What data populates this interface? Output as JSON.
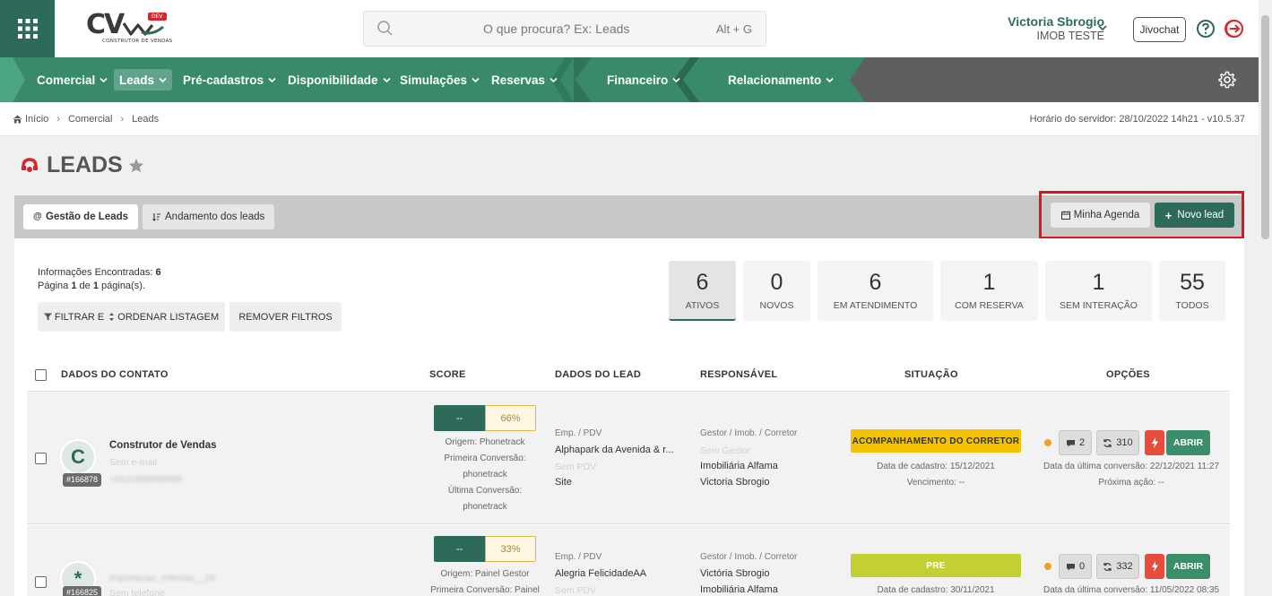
{
  "logo": {
    "text": "CV",
    "badge": "DEV",
    "tagline": "CONSTRUTOR DE VENDAS"
  },
  "search": {
    "placeholder": "O que procura? Ex: Leads",
    "shortcut": "Alt + G"
  },
  "user": {
    "name": "Victoria Sbrogio",
    "org": "IMOB TESTE"
  },
  "header": {
    "jivochat_label": "Jivochat"
  },
  "nav": {
    "items": [
      {
        "label": "Comercial"
      },
      {
        "label": "Leads"
      },
      {
        "label": "Pré-cadastros"
      },
      {
        "label": "Disponibilidade"
      },
      {
        "label": "Simulações"
      },
      {
        "label": "Reservas"
      },
      {
        "label": "Financeiro"
      },
      {
        "label": "Relacionamento"
      }
    ]
  },
  "breadcrumb": {
    "items": [
      "Início",
      "Comercial",
      "Leads"
    ],
    "server_time": "Horário do servidor: 28/10/2022 14h21 - v10.5.37"
  },
  "page": {
    "title": "LEADS"
  },
  "tabs": [
    {
      "label": "Gestão de Leads"
    },
    {
      "label": "Andamento dos leads"
    }
  ],
  "actions": {
    "agenda": "Minha Agenda",
    "new_lead": "Novo lead"
  },
  "info": {
    "found_label": "Informações Encontradas:",
    "found_count": "6",
    "page_label": "Página",
    "page_num": "1",
    "of_label": "de",
    "total_pages": "1",
    "pages_suffix": "página(s)."
  },
  "filters": {
    "filter_left": "FILTRAR E",
    "filter_right": "ORDENAR LISTAGEM",
    "remove": "REMOVER FILTROS"
  },
  "stats": [
    {
      "value": "6",
      "label": "ATIVOS"
    },
    {
      "value": "0",
      "label": "NOVOS"
    },
    {
      "value": "6",
      "label": "EM ATENDIMENTO"
    },
    {
      "value": "1",
      "label": "COM RESERVA"
    },
    {
      "value": "1",
      "label": "SEM INTERAÇÃO"
    },
    {
      "value": "55",
      "label": "TODOS"
    }
  ],
  "table": {
    "headers": [
      "DADOS DO CONTATO",
      "SCORE",
      "DADOS DO LEAD",
      "RESPONSÁVEL",
      "SITUAÇÃO",
      "OPÇÕES"
    ],
    "rows": [
      {
        "avatar": "C",
        "id": "#166878",
        "name": "Construtor de Vendas",
        "email": "Sem e-mail",
        "phone": "+5511999999999",
        "score_left": "--",
        "score_right": "66%",
        "origin": "Origem: Phonetrack",
        "first_conv_label": "Primeira Conversão:",
        "first_conv": "phonetrack",
        "last_conv_label": "Última Conversão:",
        "last_conv": "phonetrack",
        "emp_label": "Emp. / PDV",
        "emp": "Alphapark da Avenida & r...",
        "pdv": "Sem PDV",
        "site": "Site",
        "resp_label": "Gestor / Imob. / Corretor",
        "gestor": "Sem Gestor",
        "imob": "Imobiliária Alfama",
        "corretor": "Victoria Sbrogio",
        "status": "ACOMPANHAMENTO DO CORRETOR",
        "cad_date": "Data de cadastro: 15/12/2021",
        "venc": "Vencimento: --",
        "comments": "2",
        "interactions": "310",
        "last_conv_date": "Data da última conversão: 22/12/2021 11:27",
        "next_action": "Próxima ação: --",
        "open": "ABRIR"
      },
      {
        "avatar": "*",
        "id": "#166825",
        "name": "importacao_criterias__16",
        "email": "Sem telefone",
        "score_left": "--",
        "score_right": "33%",
        "origin": "Origem: Painel Gestor",
        "first_conv_label": "Primeira Conversão: Painel",
        "emp_label": "Emp. / PDV",
        "emp": "Alegria FelicidadeAA",
        "pdv": "Sem PDV",
        "resp_label": "Gestor / Imob. / Corretor",
        "gestor": "Victória Sbrogio",
        "imob": "Imobiliária Alfama",
        "status": "PRE",
        "cad_date": "Data de cadastro: 30/11/2021",
        "comments": "0",
        "interactions": "332",
        "last_conv_date": "Data da última conversão: 11/05/2022 08:35",
        "open": "ABRIR"
      }
    ]
  },
  "colors": {
    "primary": "#2d6a5a",
    "nav_dark": "#5f5f5f",
    "status_yellow": "#f4c300",
    "status_lime": "#c3d033",
    "danger": "#e74c3c",
    "highlight": "#e3121c"
  }
}
